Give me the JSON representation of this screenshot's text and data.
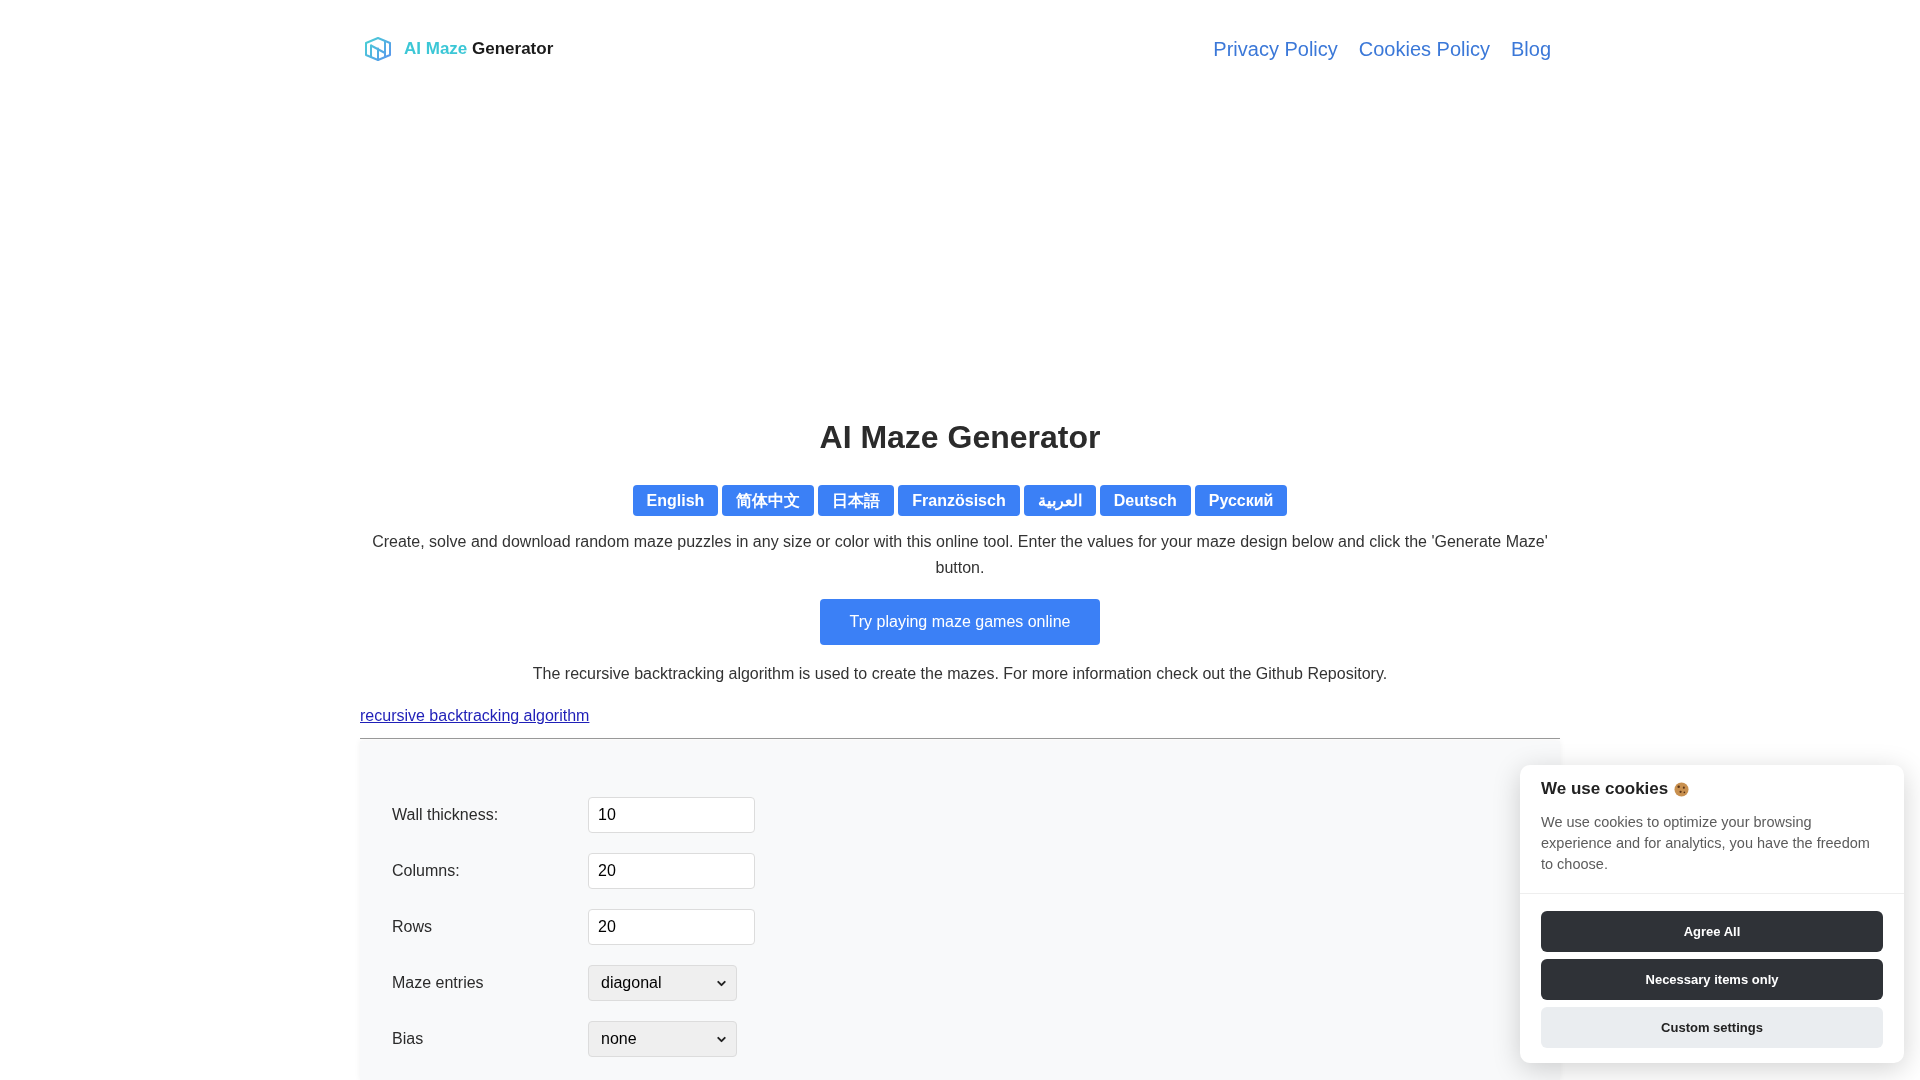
{
  "header": {
    "logo": {
      "accent": "AI Maze",
      "text": "Generator"
    },
    "nav_links": [
      "Privacy Policy",
      "Cookies Policy",
      "Blog"
    ]
  },
  "main": {
    "title": "AI Maze Generator",
    "languages": [
      "English",
      "简体中文",
      "日本語",
      "Französisch",
      "العربية",
      "Deutsch",
      "Русский"
    ],
    "intro": "Create, solve and download random maze puzzles in any size or color with this online tool. Enter the values for your maze design below and click the 'Generate Maze' button.",
    "play_button": "Try playing maze games online",
    "algorithm_note": "The recursive backtracking algorithm is used to create the mazes. For more information check out the Github Repository.",
    "algorithm_link": "recursive backtracking algorithm"
  },
  "form": {
    "fields": [
      {
        "kind": "input",
        "label": "Wall thickness:",
        "value": "10"
      },
      {
        "kind": "input",
        "label": "Columns:",
        "value": "20"
      },
      {
        "kind": "input",
        "label": "Rows",
        "value": "20"
      },
      {
        "kind": "select",
        "label": "Maze entries",
        "value": "diagonal"
      },
      {
        "kind": "select",
        "label": "Bias",
        "value": "none"
      }
    ]
  },
  "cookie_banner": {
    "title": "We use cookies",
    "text": "We use cookies to optimize your browsing experience and for analytics, you have the freedom to choose.",
    "buttons": [
      {
        "kind": "primary",
        "label": "Agree All"
      },
      {
        "kind": "primary",
        "label": "Necessary items only"
      },
      {
        "kind": "secondary",
        "label": "Custom settings"
      }
    ]
  }
}
